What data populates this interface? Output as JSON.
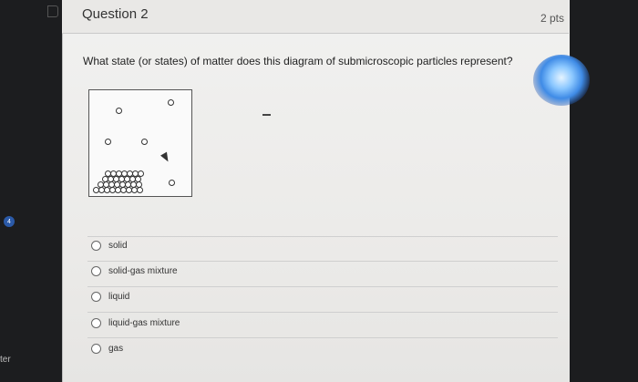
{
  "question": {
    "title": "Question 2",
    "points": "2 pts",
    "prompt": "What state (or states) of matter does this diagram of submicroscopic particles represent?"
  },
  "badge": "4",
  "side_text": "ter",
  "options": [
    {
      "label": "solid"
    },
    {
      "label": "solid-gas mixture"
    },
    {
      "label": "liquid"
    },
    {
      "label": "liquid-gas mixture"
    },
    {
      "label": "gas"
    }
  ]
}
